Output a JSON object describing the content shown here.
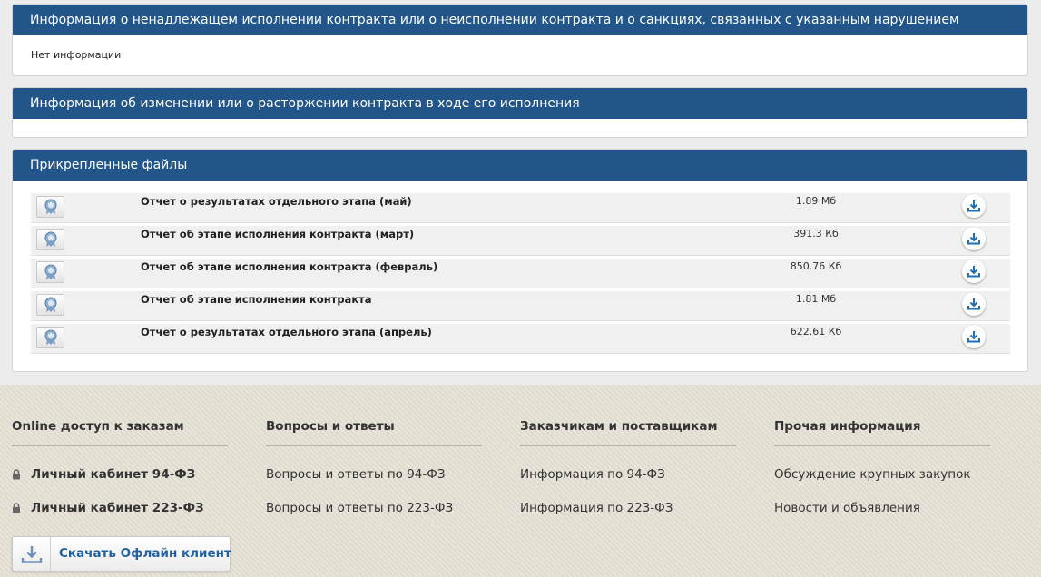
{
  "panels": {
    "violations": {
      "title": "Информация о ненадлежащем исполнении контракта или о неисполнении контракта и о санкциях, связанных с указанным нарушением",
      "body": "Нет информации"
    },
    "changes": {
      "title": "Информация об изменении или о расторжении контракта в ходе его исполнения"
    },
    "files": {
      "title": "Прикрепленные файлы",
      "items": [
        {
          "name": "Отчет о результатах отдельного этапа (май)",
          "size": "1.89 Мб"
        },
        {
          "name": "Отчет об этапе исполнения контракта (март)",
          "size": "391.3 Кб"
        },
        {
          "name": "Отчет об этапе исполнения контракта (февраль)",
          "size": "850.76 Кб"
        },
        {
          "name": "Отчет об этапе исполнения контракта",
          "size": "1.81 Мб"
        },
        {
          "name": "Отчет о результатах отдельного этапа (апрель)",
          "size": "622.61 Кб"
        }
      ]
    }
  },
  "footer": {
    "columns": [
      {
        "title": "Online доступ к заказам",
        "links": [
          "Личный кабинет 94-ФЗ",
          "Личный кабинет 223-ФЗ"
        ]
      },
      {
        "title": "Вопросы и ответы",
        "links": [
          "Вопросы и ответы по 94-ФЗ",
          "Вопросы и ответы по 223-ФЗ"
        ]
      },
      {
        "title": "Заказчикам и поставщикам",
        "links": [
          "Информация по 94-ФЗ",
          "Информация по 223-ФЗ"
        ]
      },
      {
        "title": "Прочая информация",
        "links": [
          "Обсуждение крупных закупок",
          "Новости и объявления"
        ]
      }
    ],
    "offline_button": "Скачать Офлайн клиент"
  },
  "colors": {
    "header": "#22568a",
    "link_accent": "#2161a3",
    "footer_bg": "#e4dfd3"
  },
  "icons": {
    "cert": "certificate-seal-icon",
    "download": "download-icon",
    "lock": "lock-icon"
  }
}
